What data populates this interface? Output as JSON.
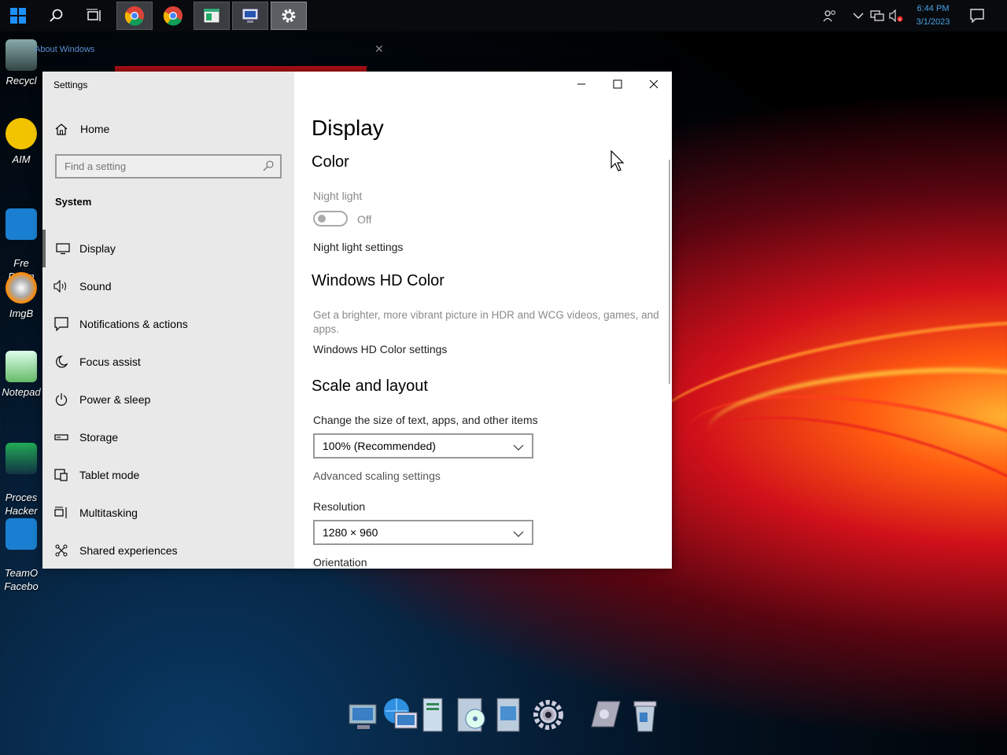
{
  "taskbar": {
    "start_icon": "windows-logo-icon",
    "search_icon": "search-icon",
    "task_view_icon": "task-view-icon",
    "apps": [
      {
        "name": "chrome-app",
        "icon": "chrome-icon"
      },
      {
        "name": "chrome-app-2",
        "icon": "chrome-icon"
      },
      {
        "name": "window-app",
        "icon": "window-icon"
      },
      {
        "name": "remote-desktop-app",
        "icon": "remote-desktop-icon"
      },
      {
        "name": "settings-app",
        "icon": "gear-icon"
      }
    ],
    "tray": [
      "people-icon",
      "chevron-up-icon",
      "network-icon",
      "volume-muted-icon"
    ],
    "time": "6:44 PM",
    "date": "3/1/2023",
    "notification_icon": "action-center-icon"
  },
  "desktop_icons": [
    {
      "label": "Recycl"
    },
    {
      "label": "AIM"
    },
    {
      "label": "Fre\nDown"
    },
    {
      "label": "ImgB"
    },
    {
      "label": "Notepad"
    },
    {
      "label": "Proces\nHacker"
    },
    {
      "label": "TeamO\nFacebo"
    }
  ],
  "background_window": {
    "title": "About Windows"
  },
  "settings_window": {
    "title": "Settings",
    "home_label": "Home",
    "search_placeholder": "Find a setting",
    "section": "System",
    "nav_items": [
      {
        "label": "Display",
        "icon": "monitor-icon",
        "selected": true
      },
      {
        "label": "Sound",
        "icon": "speaker-icon"
      },
      {
        "label": "Notifications & actions",
        "icon": "notification-icon"
      },
      {
        "label": "Focus assist",
        "icon": "moon-icon"
      },
      {
        "label": "Power & sleep",
        "icon": "power-icon"
      },
      {
        "label": "Storage",
        "icon": "storage-icon"
      },
      {
        "label": "Tablet mode",
        "icon": "tablet-icon"
      },
      {
        "label": "Multitasking",
        "icon": "multitasking-icon"
      },
      {
        "label": "Shared experiences",
        "icon": "shared-experiences-icon"
      }
    ],
    "content": {
      "page_title": "Display",
      "color_heading": "Color",
      "night_light_label": "Night light",
      "night_light_state": "Off",
      "night_light_settings": "Night light settings",
      "hd_color_heading": "Windows HD Color",
      "hd_color_desc": "Get a brighter, more vibrant picture in HDR and WCG videos, games, and apps.",
      "hd_color_settings": "Windows HD Color settings",
      "scale_heading": "Scale and layout",
      "scale_label": "Change the size of text, apps, and other items",
      "scale_value": "100% (Recommended)",
      "advanced_scaling": "Advanced scaling settings",
      "resolution_label": "Resolution",
      "resolution_value": "1280 × 960",
      "orientation_label": "Orientation"
    }
  }
}
